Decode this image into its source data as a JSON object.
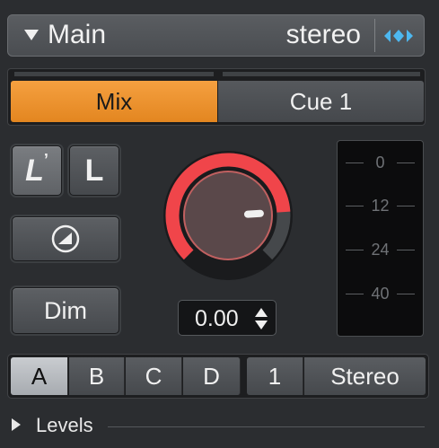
{
  "header": {
    "title": "Main",
    "mode": "stereo",
    "expand_icon": "triangle-down-icon",
    "link_icon": "stereo-link-icon",
    "link_color": "#4db8f0"
  },
  "tabs": [
    {
      "label": "Mix",
      "active": true
    },
    {
      "label": "Cue 1",
      "active": false
    }
  ],
  "accent_color": "#f0962e",
  "buttons": {
    "speaker_a": "L",
    "speaker_b": "L",
    "mute_icon": "circle-slope-icon",
    "dim": "Dim"
  },
  "knob": {
    "value": "0.00",
    "level_fraction": 0.82,
    "ring_color": "#f0454a"
  },
  "meter": {
    "ticks": [
      "0",
      "12",
      "24",
      "40"
    ]
  },
  "bottom": {
    "sets": [
      "A",
      "B",
      "C",
      "D"
    ],
    "active_set": "A",
    "channel": "1",
    "output": "Stereo"
  },
  "levels": {
    "label": "Levels"
  }
}
